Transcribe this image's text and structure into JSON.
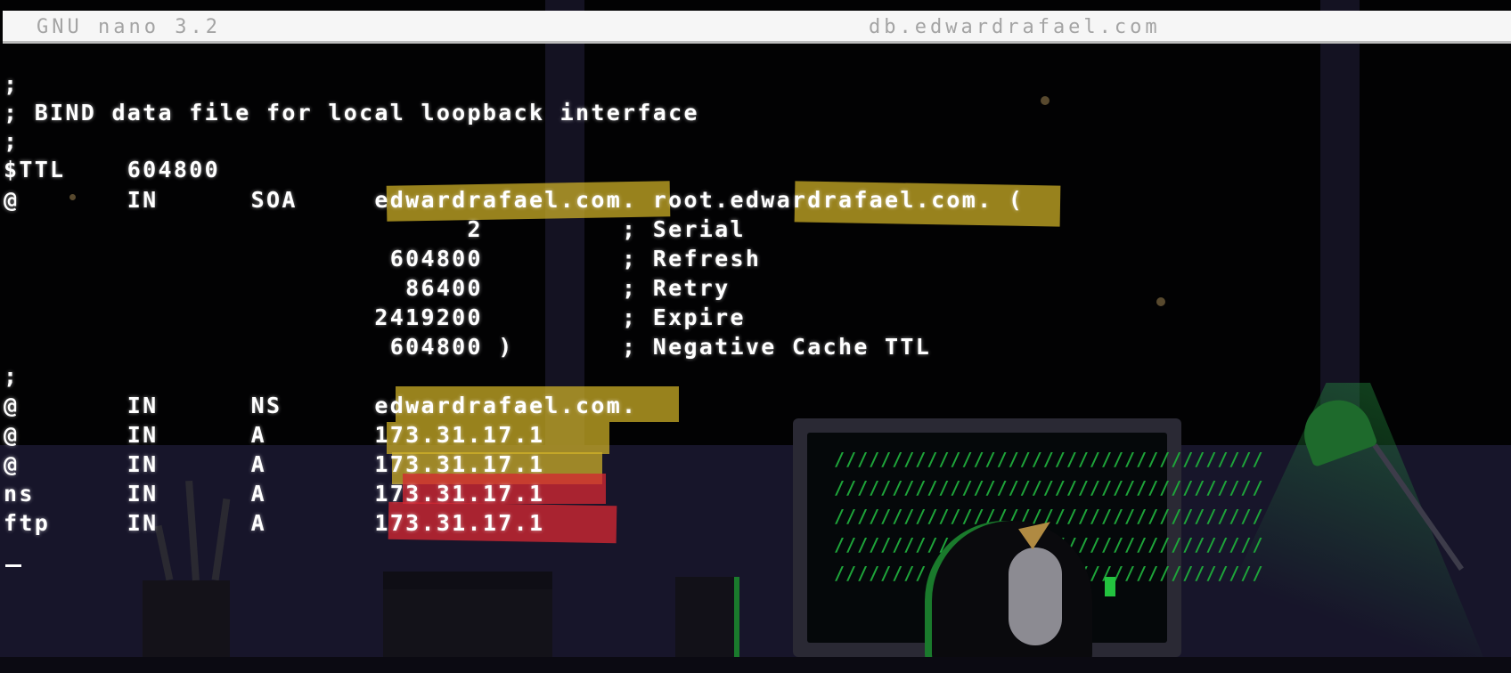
{
  "titlebar": {
    "version": "GNU nano 3.2",
    "filename": "db.edwardrafael.com"
  },
  "file_lines": [
    ";",
    "; BIND data file for local loopback interface",
    ";",
    "$TTL    604800",
    "@       IN      SOA     edwardrafael.com. root.edwardrafael.com. (",
    "                              2         ; Serial",
    "                         604800         ; Refresh",
    "                          86400         ; Retry",
    "                        2419200         ; Expire",
    "                         604800 )       ; Negative Cache TTL",
    ";",
    "@       IN      NS      edwardrafael.com.",
    "@       IN      A       173.31.17.1",
    "@       IN      A       173.31.17.1",
    "ns      IN      A       173.31.17.1",
    "ftp     IN      A       173.31.17.1"
  ],
  "screen_pattern": "/////////////////////////////////////",
  "colors": {
    "highlight_yellow": "#d2b428",
    "highlight_red": "#d22832",
    "terminal_text": "#ffffff",
    "monitor_green": "#1ea53a"
  }
}
